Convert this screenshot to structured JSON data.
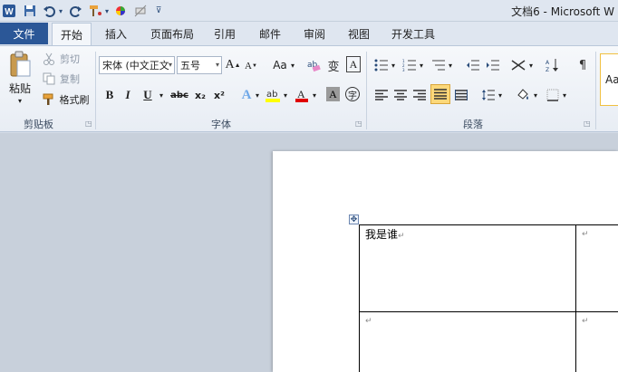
{
  "titlebar": {
    "title": "文档6 - Microsoft W",
    "quick_access": {
      "word_icon": "word-logo-icon",
      "save_icon": "save-icon",
      "undo_icon": "undo-icon",
      "redo_icon": "redo-icon",
      "customize_icon": "customize-dropdown-icon"
    }
  },
  "tabs": {
    "file": "文件",
    "items": [
      "开始",
      "插入",
      "页面布局",
      "引用",
      "邮件",
      "审阅",
      "视图",
      "开发工具"
    ]
  },
  "clipboard": {
    "label": "剪贴板",
    "paste": "粘贴",
    "cut": "剪切",
    "copy": "复制",
    "format_painter": "格式刷"
  },
  "font": {
    "label": "字体",
    "font_name": "宋体 (中文正文",
    "font_size": "五号",
    "grow": "A",
    "shrink": "A",
    "change_case": "Aa",
    "bold": "B",
    "italic": "I",
    "underline": "U",
    "strike": "abc",
    "subscript": "x₂",
    "superscript": "x²",
    "highlight_color": "#ffff00",
    "font_color": "#e00000"
  },
  "paragraph": {
    "label": "段落"
  },
  "styles": {
    "preview": "Aa"
  },
  "document": {
    "cell_text": "我是谁",
    "paragraph_mark": "↵"
  }
}
